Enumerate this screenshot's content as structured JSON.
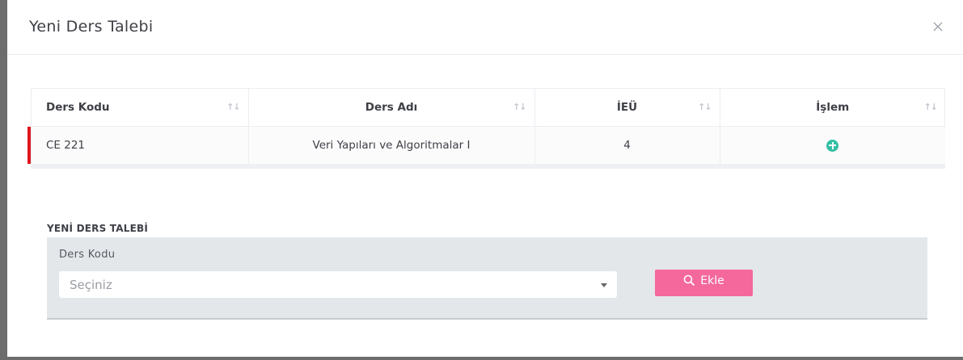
{
  "modal": {
    "title": "Yeni Ders Talebi"
  },
  "table": {
    "headers": [
      "Ders Kodu",
      "Ders Adı",
      "İEÜ",
      "İşlem"
    ],
    "sort_glyph": "↑↓",
    "rows": [
      {
        "code": "CE 221",
        "name": "Veri Yapıları ve Algoritmalar I",
        "ieu": "4",
        "action_icon": "plus-circle-icon"
      }
    ]
  },
  "form": {
    "section_title": "YENİ DERS TALEBİ",
    "field_label": "Ders Kodu",
    "select_placeholder": "Seçiniz",
    "add_button_label": "Ekle"
  },
  "colors": {
    "accent_pink": "#f4689b",
    "success_green": "#34bfa3",
    "row_marker_red": "#e0151e"
  }
}
